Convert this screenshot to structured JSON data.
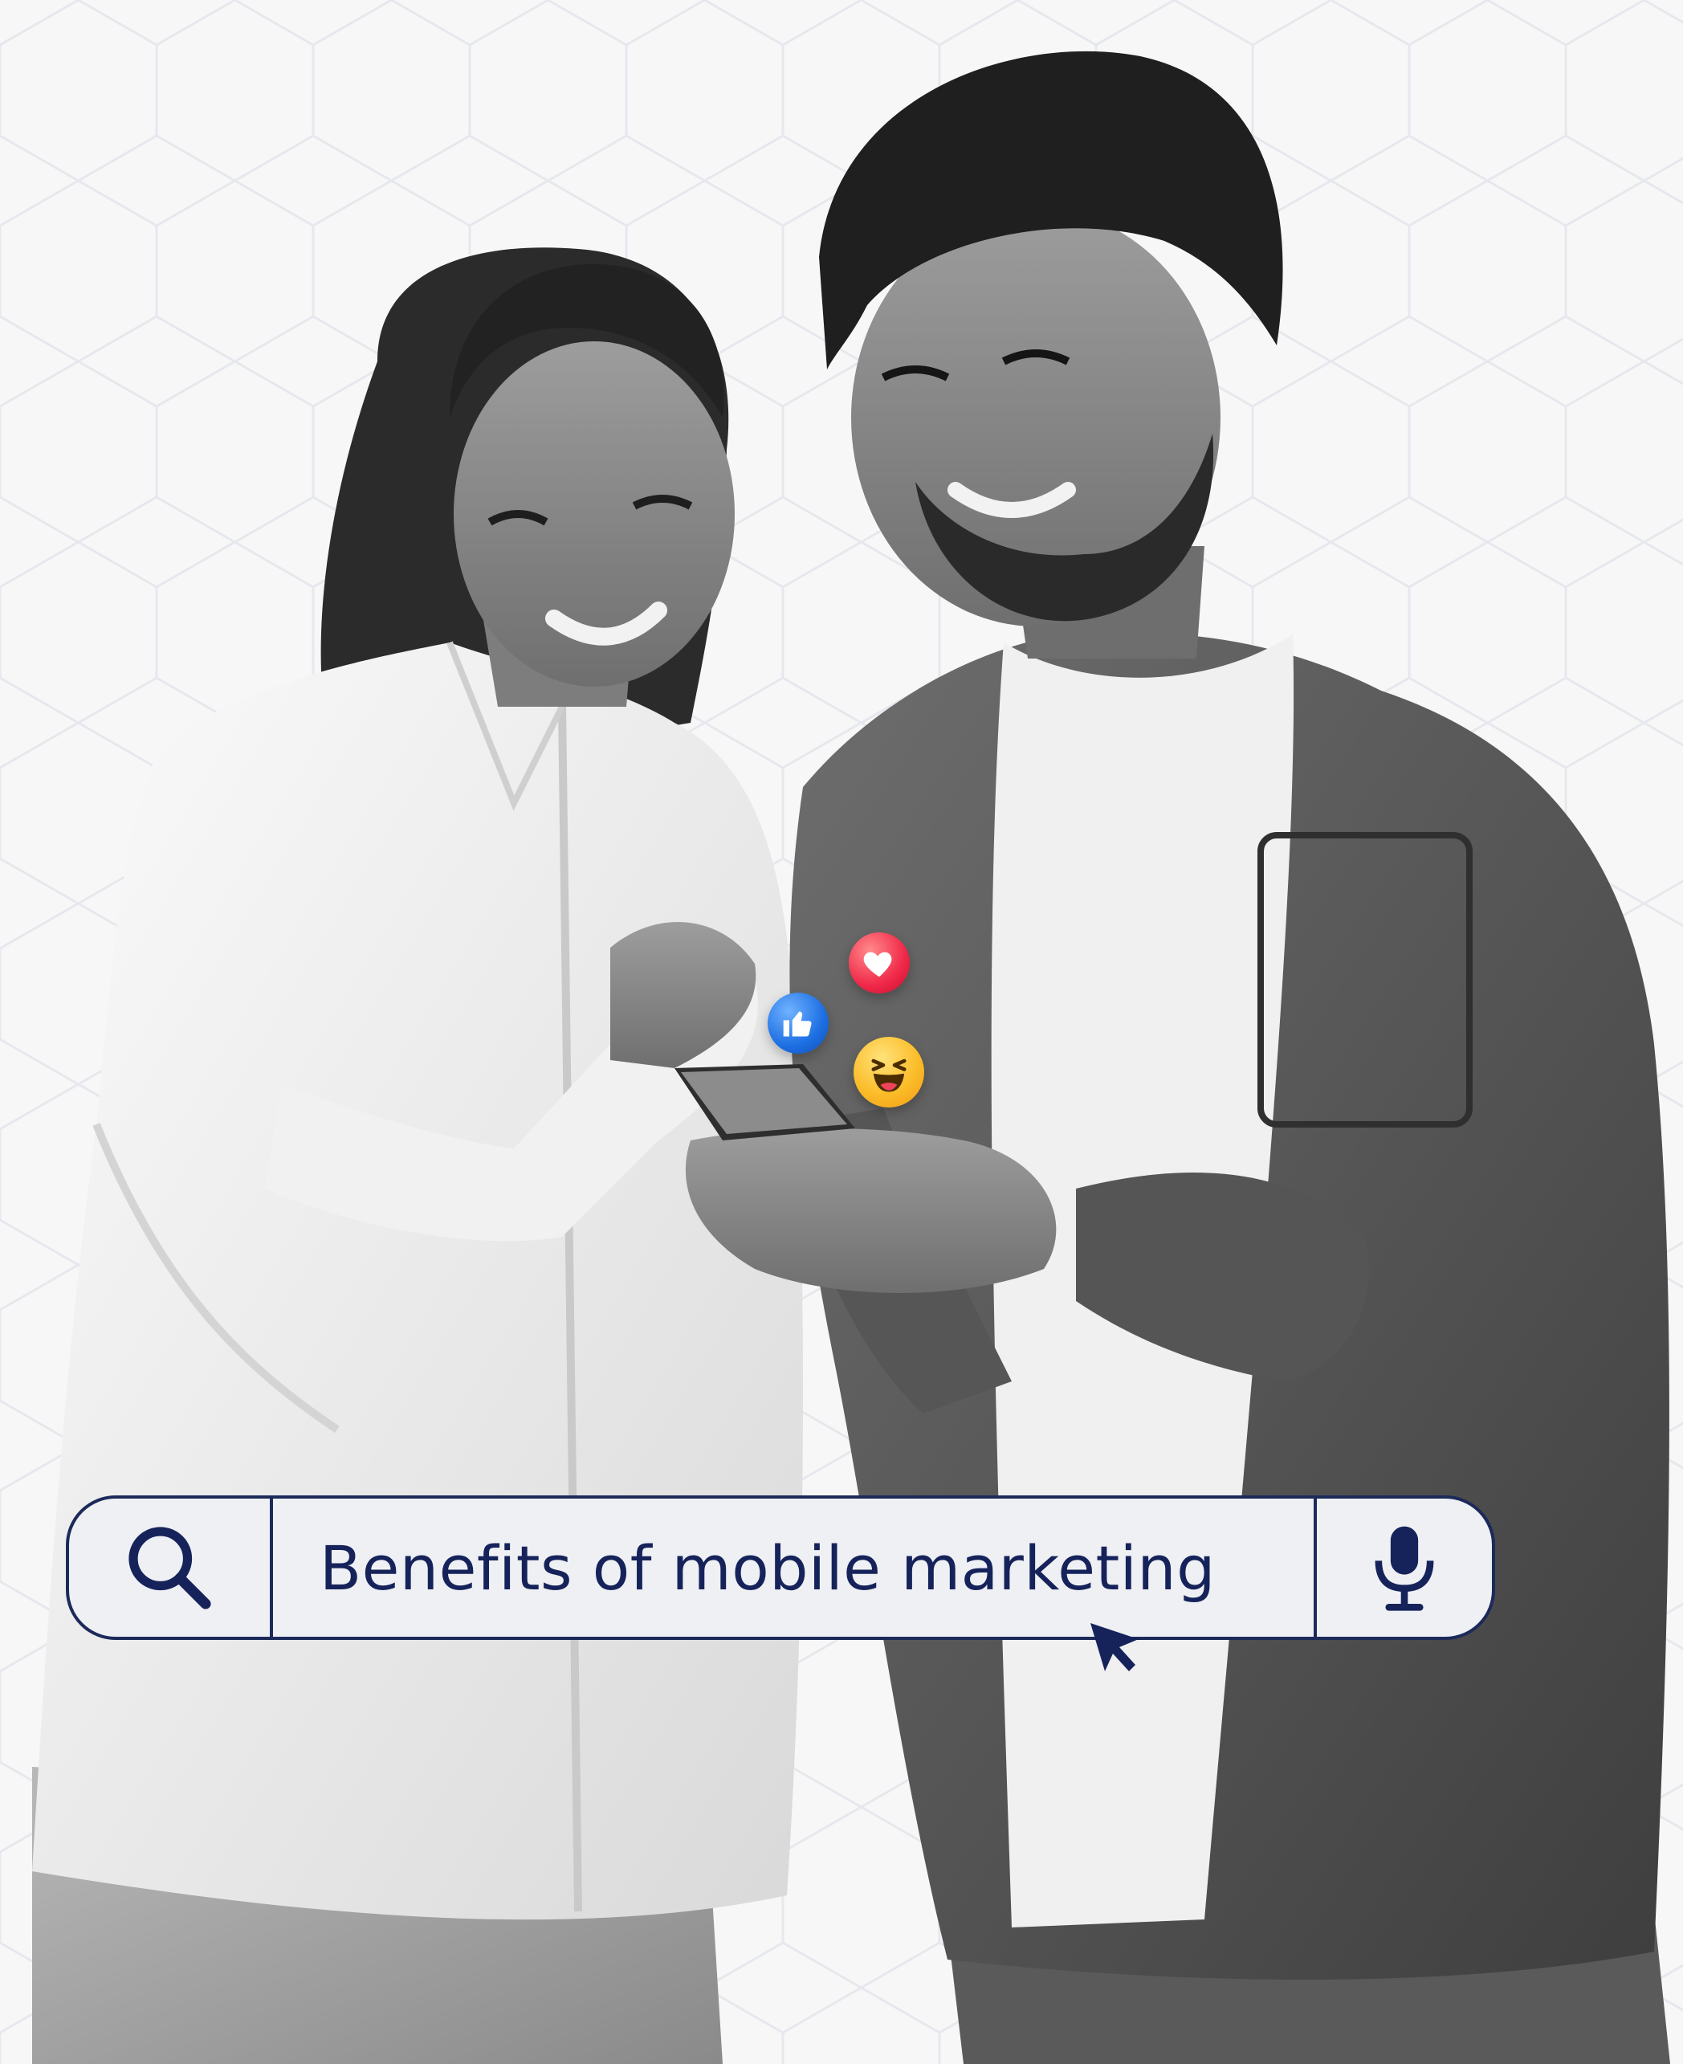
{
  "search": {
    "query": "Benefits of mobile marketing",
    "search_icon": "search-icon",
    "mic_icon": "microphone-icon"
  },
  "reactions": [
    "like-icon",
    "love-icon",
    "haha-icon"
  ],
  "cursor_icon": "pointer-cursor-icon",
  "colors": {
    "background": "#f7f7f7",
    "search_border": "#1c2a5a",
    "search_fill": "#eef0f4",
    "query_text": "#16235a"
  }
}
